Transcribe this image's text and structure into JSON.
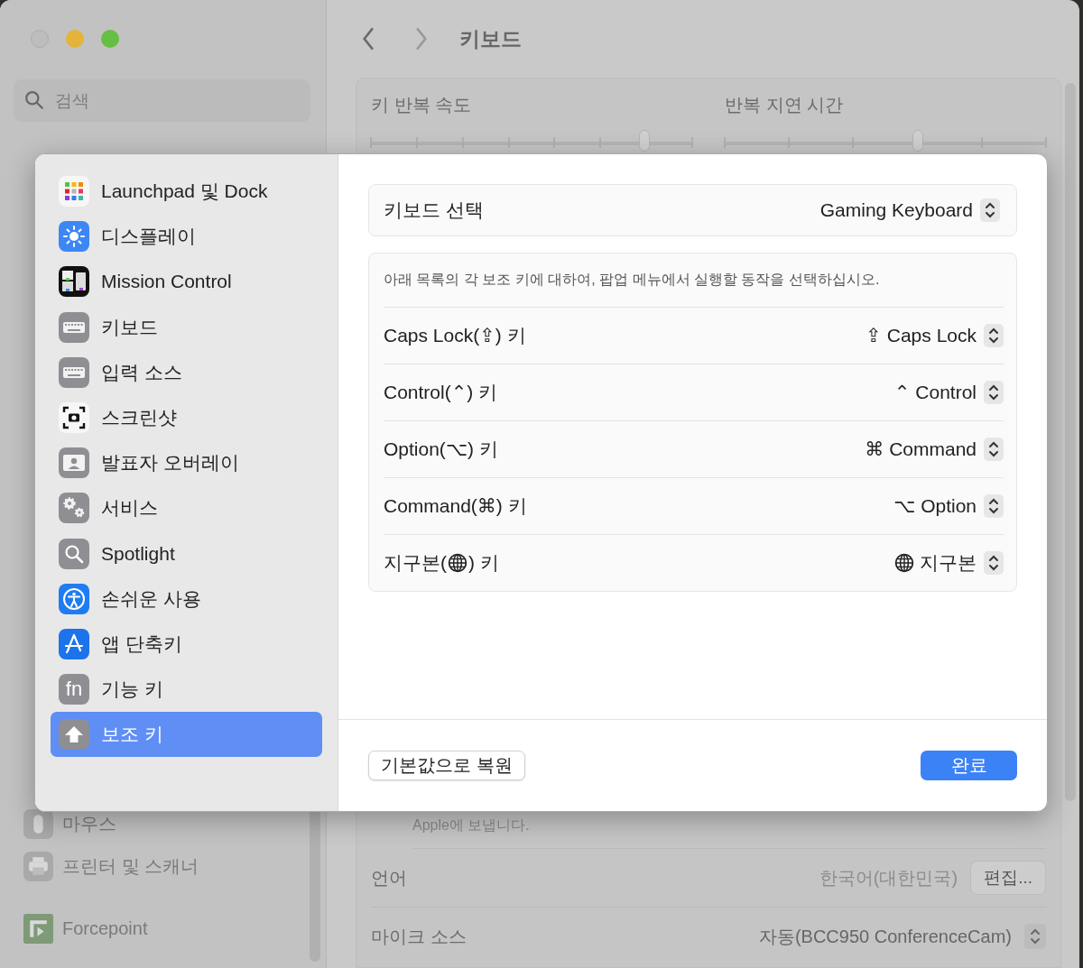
{
  "window": {
    "title": "키보드"
  },
  "search": {
    "placeholder": "검색"
  },
  "sidebar": {
    "items": [
      {
        "label": "마우스"
      },
      {
        "label": "프린터 및 스캐너"
      }
    ],
    "footer_items": [
      {
        "label": "Forcepoint"
      }
    ]
  },
  "key_repeat": [
    {
      "label": "키 반복 속도",
      "level": 0.85
    },
    {
      "label": "반복 지연 시간",
      "level": 0.6
    }
  ],
  "note": "Apple에 보냅니다.",
  "settings_rows": [
    {
      "label": "언어",
      "value": "한국어(대한민국)",
      "kind": "button",
      "button": "편집..."
    },
    {
      "label": "마이크 소스",
      "value": "자동(BCC950 ConferenceCam)",
      "kind": "popup"
    }
  ],
  "dialog": {
    "categories": [
      {
        "label": "Launchpad 및 Dock",
        "selected": false
      },
      {
        "label": "디스플레이",
        "selected": false
      },
      {
        "label": "Mission Control",
        "selected": false
      },
      {
        "label": "키보드",
        "selected": false
      },
      {
        "label": "입력 소스",
        "selected": false
      },
      {
        "label": "스크린샷",
        "selected": false
      },
      {
        "label": "발표자 오버레이",
        "selected": false
      },
      {
        "label": "서비스",
        "selected": false
      },
      {
        "label": "Spotlight",
        "selected": false
      },
      {
        "label": "손쉬운 사용",
        "selected": false
      },
      {
        "label": "앱 단축키",
        "selected": false
      },
      {
        "label": "기능 키",
        "icon_text": "fn",
        "selected": false
      },
      {
        "label": "보조 키",
        "selected": true
      }
    ],
    "keyboard_select": {
      "label": "키보드 선택",
      "value": "Gaming Keyboard"
    },
    "description": "아래 목록의 각 보조 키에 대하여, 팝업 메뉴에서 실행할 동작을 선택하십시오.",
    "modifiers": [
      {
        "kind": "text",
        "label": "Caps Lock(⇪) 키",
        "value": "⇪ Caps Lock"
      },
      {
        "kind": "text",
        "label": "Control(⌃) 키",
        "value": "⌃ Control"
      },
      {
        "kind": "text",
        "label": "Option(⌥) 키",
        "value": "⌘ Command"
      },
      {
        "kind": "text",
        "label": "Command(⌘) 키",
        "value": "⌥ Option"
      },
      {
        "kind": "globe",
        "label": "지구본(",
        "label_end": ") 키",
        "value": "지구본"
      }
    ],
    "buttons": [
      {
        "label": "기본값으로 복원",
        "kind": "secondary"
      },
      {
        "label": "완료",
        "kind": "primary"
      }
    ]
  }
}
